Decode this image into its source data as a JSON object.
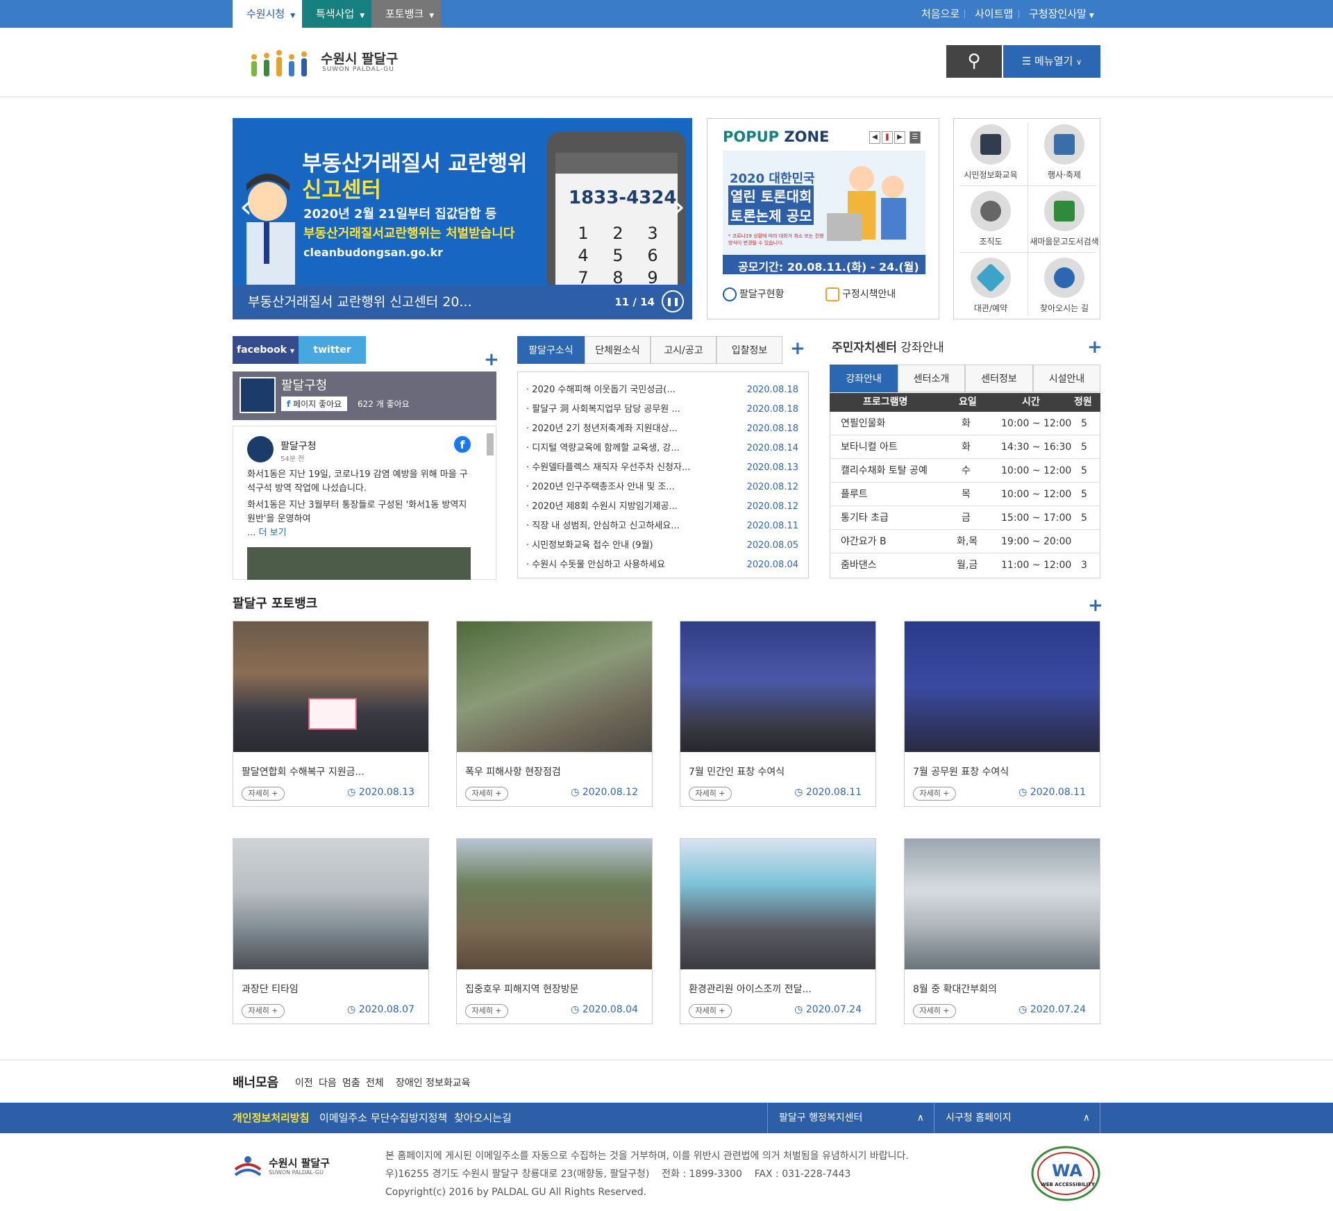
{
  "topbar": {
    "tabs": [
      "수원시청",
      "특색사업",
      "포토뱅크"
    ],
    "right_links": [
      "처음으로",
      "사이트맵",
      "구청장인사말"
    ]
  },
  "header": {
    "logo_title": "수원시 팔달구",
    "logo_sub": "SUWON PALDAL-GU",
    "menu_label": "메뉴열기"
  },
  "hero": {
    "headline1": "부동산거래질서 교란행위",
    "headline2": "신고센터",
    "line1": "2020년 2월 21일부터 집값담합 등",
    "line2": "부동산거래질서교란행위는 처벌받습니다",
    "url": "cleanbudongsan.go.kr",
    "phone": "1833-4324",
    "keys": [
      "1",
      "2",
      "3",
      "4",
      "5",
      "6",
      "7",
      "8",
      "9"
    ],
    "caption": "부동산거래질서 교란행위 신고센터 20...",
    "page": "11 / 14"
  },
  "popup": {
    "title_a": "POPUP",
    "title_b": " ZONE",
    "img_title1": "2020 대한민국",
    "img_title2": "열린 토론대회",
    "img_title3": "토론논제 공모",
    "img_note": "* 코로나19 상황에 따라 대회가 취소 또는 진행 방식이 변경될 수 있습니다.",
    "img_period": "공모기간: 20.08.11.(화) - 24.(월)",
    "link1": "팔달구현황",
    "link2": "구정시책안내"
  },
  "quick": [
    "시민정보화교육",
    "행사·축제",
    "조직도",
    "새마을문고도서검색",
    "대관/예약",
    "찾아오시는 길"
  ],
  "sns": {
    "tabs": [
      "facebook",
      "twitter"
    ],
    "cover_name": "팔달구청",
    "like_btn": "페이지 좋아요",
    "like_count": "622 개 좋아요",
    "post_name": "팔달구청",
    "post_time": "54분 전",
    "post_p1": "화서1동은 지난 19일, 코로나19 감염 예방을 위해 마을 구석구석 방역 작업에 나섰습니다.",
    "post_p2": "화서1동은 지난 3월부터 통장들로 구성된 '화서1동 방역지원반'을 운영하여",
    "post_more": "... 더 보기"
  },
  "news": {
    "tabs": [
      "팔달구소식",
      "단체원소식",
      "고시/공고",
      "입찰정보"
    ],
    "items": [
      {
        "title": "· 2020 수해피해 이웃돕기 국민성금(...",
        "date": "2020.08.18"
      },
      {
        "title": "· 팔달구 洞 사회복지업무 담당 공무원 ...",
        "date": "2020.08.18"
      },
      {
        "title": "· 2020년 2기 청년저축계좌 지원대상...",
        "date": "2020.08.18"
      },
      {
        "title": "· 디지털 역량교육에 함께할 교육생, 강...",
        "date": "2020.08.14"
      },
      {
        "title": "· 수원델타플렉스 재직자 우선주차 신청자...",
        "date": "2020.08.13"
      },
      {
        "title": "· 2020년 인구주택총조사 안내 및 조...",
        "date": "2020.08.12"
      },
      {
        "title": "· 2020년 제8회 수원시 지방임기제공...",
        "date": "2020.08.12"
      },
      {
        "title": "· 직장 내 성범죄, 안심하고 신고하세요...",
        "date": "2020.08.11"
      },
      {
        "title": "· 시민정보화교육 접수 안내 (9월)",
        "date": "2020.08.05"
      },
      {
        "title": "· 수원시 수돗물 안심하고 사용하세요",
        "date": "2020.08.04"
      }
    ]
  },
  "course": {
    "title_a": "주민자치센터",
    "title_b": " 강좌안내",
    "tabs": [
      "강좌안내",
      "센터소개",
      "센터정보",
      "시설안내"
    ],
    "headers": [
      "프로그램명",
      "요일",
      "시간",
      "정원"
    ],
    "rows": [
      [
        "연필인물화",
        "화",
        "10:00 ~ 12:00",
        "5"
      ],
      [
        "보타니컬 아트",
        "화",
        "14:30 ~ 16:30",
        "5"
      ],
      [
        "캘리수채화 토탈 공예",
        "수",
        "10:00 ~ 12:00",
        "5"
      ],
      [
        "플루트",
        "목",
        "10:00 ~ 12:00",
        "5"
      ],
      [
        "통기타 초급",
        "금",
        "15:00 ~ 17:00",
        "5"
      ],
      [
        "야간요가 B",
        "화,목",
        "19:00 ~ 20:00",
        ""
      ],
      [
        "줌바댄스",
        "월,금",
        "11:00 ~ 12:00",
        "3"
      ]
    ]
  },
  "photobank": {
    "title": "팔달구 포토뱅크",
    "more_label": "자세히 +",
    "items": [
      {
        "caption": "팔달연합회 수해복구 지원금...",
        "date": "2020.08.13"
      },
      {
        "caption": "폭우 피해사항 현장점검",
        "date": "2020.08.12"
      },
      {
        "caption": "7월 민간인 표창 수여식",
        "date": "2020.08.11"
      },
      {
        "caption": "7월 공무원 표창 수여식",
        "date": "2020.08.11"
      },
      {
        "caption": "과장단 티타임",
        "date": "2020.08.07"
      },
      {
        "caption": "집중호우 피해지역 현장방문",
        "date": "2020.08.04"
      },
      {
        "caption": "환경관리원 아이스조끼 전달...",
        "date": "2020.07.24"
      },
      {
        "caption": "8월 중 확대간부회의",
        "date": "2020.07.24"
      }
    ]
  },
  "banner": {
    "label": "배너모음",
    "controls": [
      "이전",
      "다음",
      "멈춤",
      "전체"
    ],
    "item": "장애인 정보화교육"
  },
  "footer": {
    "links": [
      "개인정보처리방침",
      "이메일주소 무단수집방지정책",
      "찾아오시는길"
    ],
    "select1": "팔달구 행정복지센터",
    "select2": "시구청 홈페이지",
    "logo_title": "수원시 팔달구",
    "logo_sub": "SUWON PALDAL-GU",
    "line1": "본 홈페이지에 게시된 이메일주소를 자동으로 수집하는 것을 거부하며, 이를 위반시 관련법에 의거 처벌됨을 유념하시기 바랍니다.",
    "line2": "우)16255 경기도 수원시 팔달구 창룡대로 23(매향동, 팔달구청)    전화 : 1899-3300    FAX : 031-228-7443",
    "line3": "Copyright(c) 2016 by PALDAL GU All Rights Reserved.",
    "wa_text": "WA",
    "wa_sub": "WEB ACCESSIBILITY"
  }
}
